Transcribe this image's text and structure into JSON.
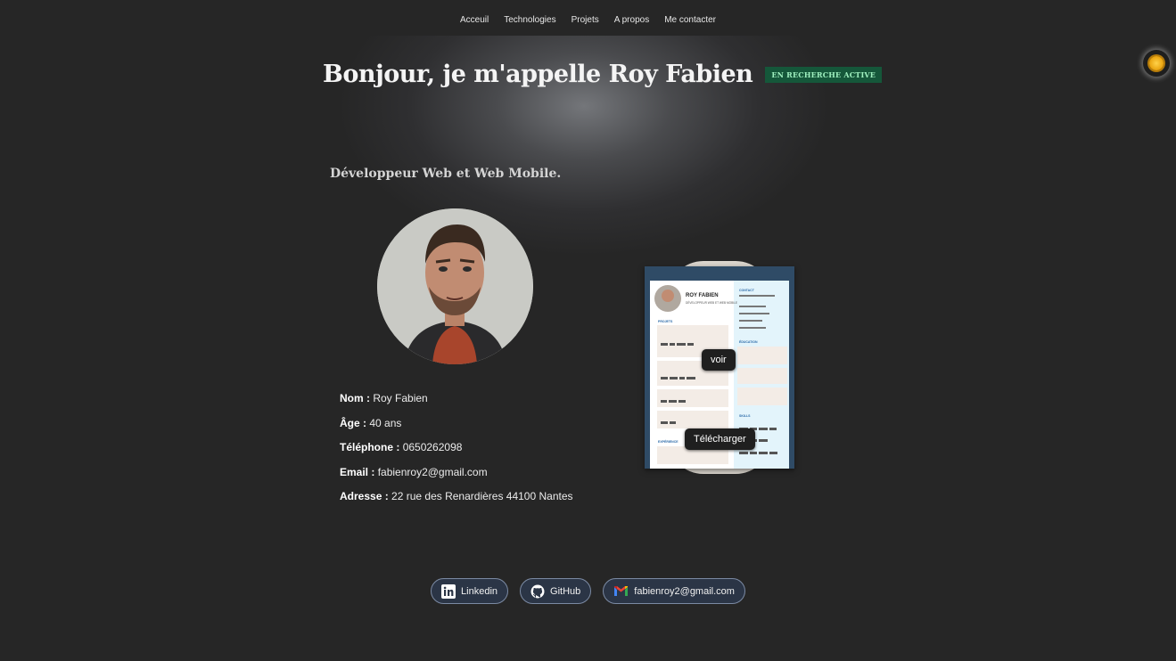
{
  "nav": {
    "items": [
      "Acceuil",
      "Technologies",
      "Projets",
      "A propos",
      "Me contacter"
    ]
  },
  "theme_toggle": {
    "icon": "sun-icon"
  },
  "hero": {
    "title": "Bonjour, je m'appelle Roy Fabien",
    "badge": "EN RECHERCHE ACTIVE",
    "subtitle": "Développeur Web et Web Mobile."
  },
  "profile": {
    "photo_alt": "photo-portrait",
    "fields": [
      {
        "label": "Nom :",
        "value": "Roy Fabien"
      },
      {
        "label": "Âge :",
        "value": "40 ans"
      },
      {
        "label": "Téléphone :",
        "value": "0650262098"
      },
      {
        "label": "Email :",
        "value": "fabienroy2@gmail.com"
      },
      {
        "label": "Adresse :",
        "value": "22 rue des Renardières 44100 Nantes"
      }
    ]
  },
  "cv": {
    "view_label": "voir",
    "download_label": "Télécharger",
    "preview": {
      "name": "ROY FABIEN",
      "role": "DÉVELOPPEUR WEB ET WEB MOBILE",
      "sections": {
        "projects": "PROJETS",
        "experience": "EXPÉRIENCE",
        "contact": "CONTACT",
        "education": "ÉDUCATION",
        "skills": "SKILLS"
      }
    }
  },
  "socials": [
    {
      "label": "Linkedin",
      "icon": "linkedin-icon"
    },
    {
      "label": "GitHub",
      "icon": "github-icon"
    },
    {
      "label": "fabienroy2@gmail.com",
      "icon": "gmail-icon"
    }
  ],
  "colors": {
    "background": "#262626",
    "badge_bg": "#15573a",
    "badge_text": "#9ff0bf",
    "pill_bg": "#2b3546",
    "pill_border": "#7b8aa3",
    "cv_frame": "#2f4b66"
  }
}
